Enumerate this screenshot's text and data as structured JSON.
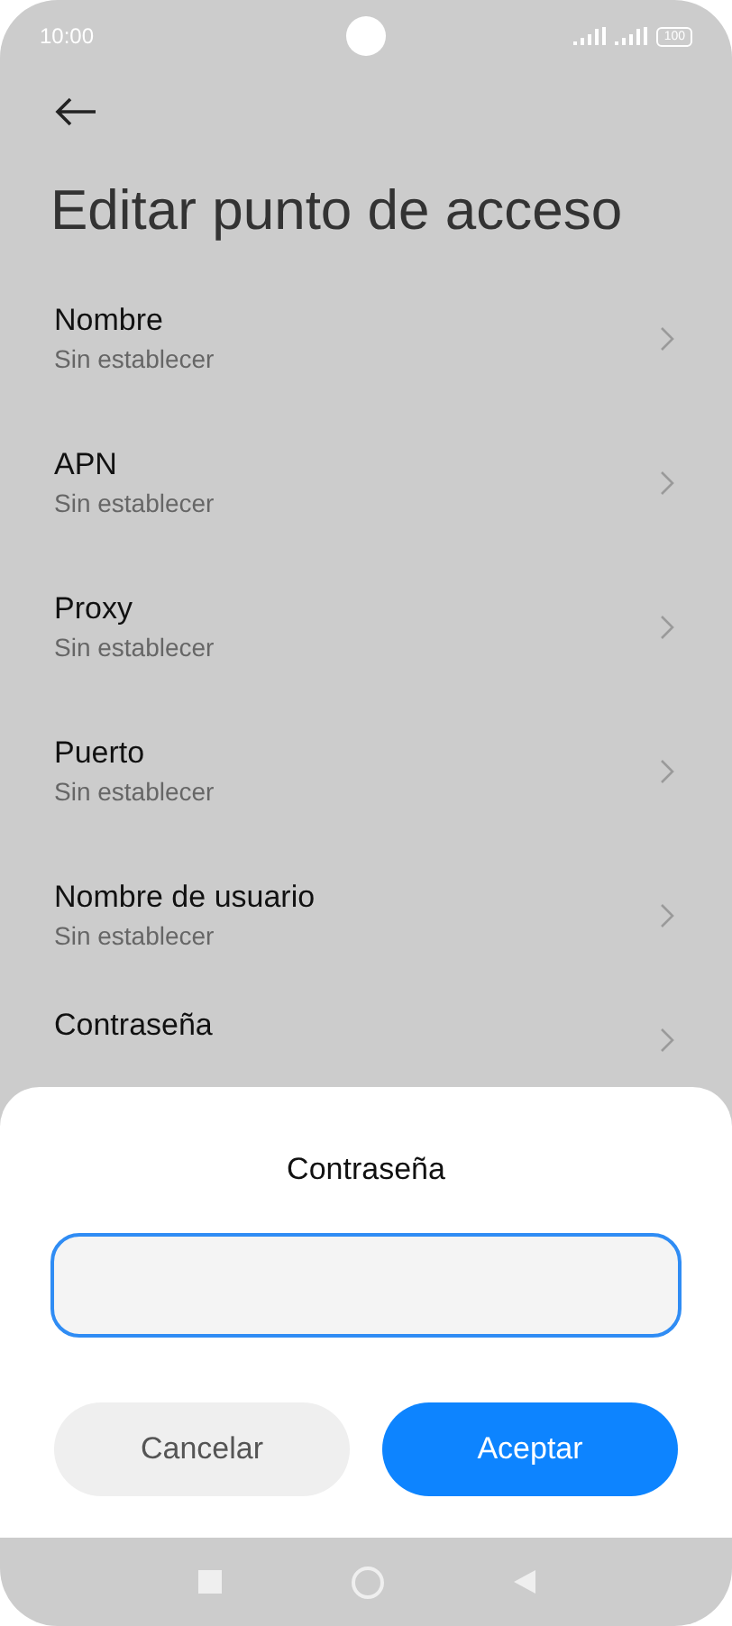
{
  "status_bar": {
    "time": "10:00",
    "battery": "100"
  },
  "title": "Editar punto de acceso",
  "items": [
    {
      "label": "Nombre",
      "value": "Sin establecer"
    },
    {
      "label": "APN",
      "value": "Sin establecer"
    },
    {
      "label": "Proxy",
      "value": "Sin establecer"
    },
    {
      "label": "Puerto",
      "value": "Sin establecer"
    },
    {
      "label": "Nombre de usuario",
      "value": "Sin establecer"
    },
    {
      "label": "Contraseña"
    }
  ],
  "dialog": {
    "title": "Contraseña",
    "cancel": "Cancelar",
    "accept": "Aceptar"
  }
}
